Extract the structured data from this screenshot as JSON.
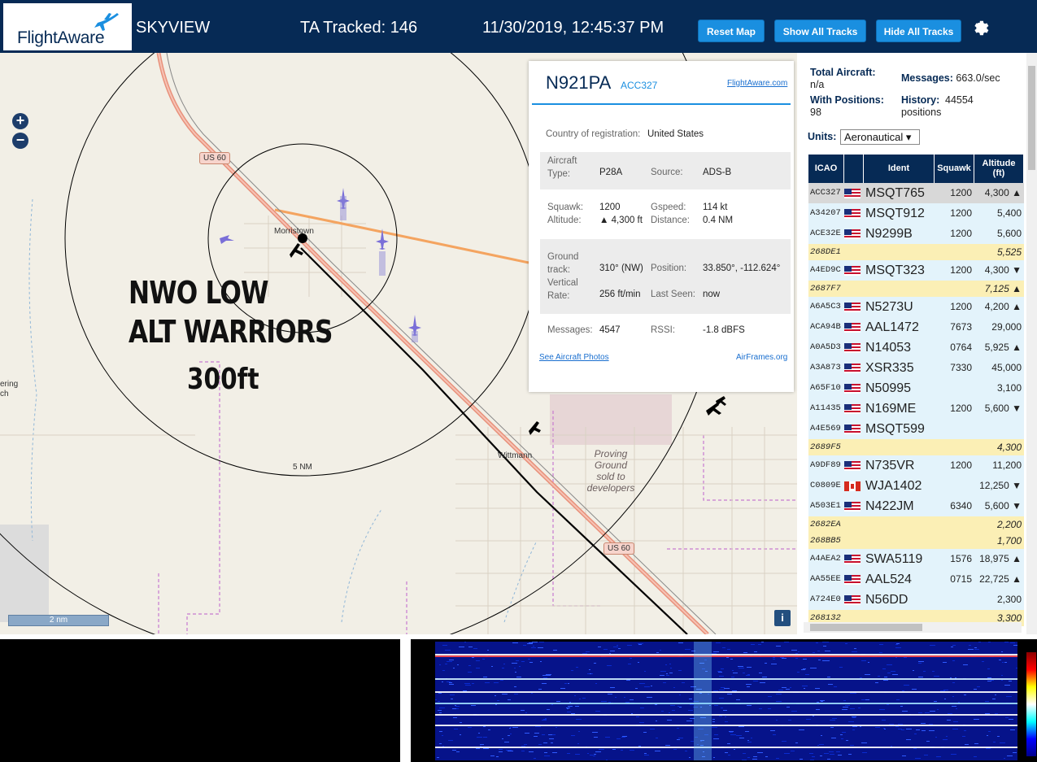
{
  "header": {
    "logo_text": "FlightAware",
    "app_title": "SKYVIEW",
    "ta_tracked": "TA Tracked: 146",
    "datetime": "11/30/2019, 12:45:37 PM",
    "buttons": {
      "reset": "Reset Map",
      "show": "Show All Tracks",
      "hide": "Hide All Tracks"
    },
    "settings_icon": "gear-icon"
  },
  "map": {
    "zoom_in": "+",
    "zoom_out": "−",
    "scale_label": "2 nm",
    "ring_label": "5 NM",
    "info_label": "i",
    "place_labels": {
      "morristown": "Morristown",
      "wittmann": "Wittmann",
      "us60a": "US 60",
      "us60b": "US 60",
      "left_fragment": "ering\nch"
    },
    "proving_ground": "Proving\nGround\nsold to\ndevelopers",
    "overlay": {
      "line1": "NWO LOW",
      "line2": "ALT WARRIORS",
      "line3": "300ft"
    }
  },
  "popup": {
    "registration": "N921PA",
    "icao": "ACC327",
    "fa_link": "FlightAware.com",
    "country_label": "Country of registration:",
    "country_value": "United States",
    "aircraft_type_label": "Aircraft\nType:",
    "aircraft_type_value": "P28A",
    "source_label": "Source:",
    "source_value": "ADS-B",
    "squawk_label": "Squawk:",
    "squawk_value": "1200",
    "gspeed_label": "Gspeed:",
    "gspeed_value": "114 kt",
    "altitude_label": "Altitude:",
    "altitude_value": "▲ 4,300 ft",
    "distance_label": "Distance:",
    "distance_value": "0.4 NM",
    "ground_track_label": "Ground\ntrack:",
    "ground_track_value": "310° (NW)",
    "position_label": "Position:",
    "position_value": "33.850°, -112.624°",
    "vrate_label": "Vertical\nRate:",
    "vrate_value": "256 ft/min",
    "last_seen_label": "Last Seen:",
    "last_seen_value": "now",
    "messages_label": "Messages:",
    "messages_value": "4547",
    "rssi_label": "RSSI:",
    "rssi_value": "-1.8 dBFS",
    "photos_link": "See Aircraft Photos",
    "airframes_link": "AirFrames.org"
  },
  "stats": {
    "total_label": "Total Aircraft:",
    "total_value": "n/a",
    "messages_label": "Messages:",
    "messages_value": "663.0/sec",
    "positions_label": "With Positions:",
    "positions_value": "98",
    "history_label": "History:",
    "history_value": "44554\npositions",
    "units_label": "Units:",
    "units_value": "Aeronautical ▾"
  },
  "table": {
    "headers": [
      "ICAO",
      "",
      "Ident",
      "Squawk",
      "Altitude\n(ft)"
    ],
    "rows": [
      {
        "icao": "ACC327",
        "flag": "us",
        "ident": "MSQT765",
        "squawk": "1200",
        "alt": "4,300 ▲",
        "bg": "#d8d8d8"
      },
      {
        "icao": "A34207",
        "flag": "us",
        "ident": "MSQT912",
        "squawk": "1200",
        "alt": "5,400",
        "bg": "#e3f3fb"
      },
      {
        "icao": "ACE32E",
        "flag": "us",
        "ident": "N9299B",
        "squawk": "1200",
        "alt": "5,600",
        "bg": "#e3f3fb"
      },
      {
        "icao": "268DE1",
        "flag": "",
        "ident": "",
        "squawk": "",
        "alt": "5,525",
        "bg": "#fbefb5"
      },
      {
        "icao": "A4ED9C",
        "flag": "us",
        "ident": "MSQT323",
        "squawk": "1200",
        "alt": "4,300 ▼",
        "bg": "#e3f3fb"
      },
      {
        "icao": "2687F7",
        "flag": "",
        "ident": "",
        "squawk": "",
        "alt": "7,125 ▲",
        "bg": "#fbefb5"
      },
      {
        "icao": "A6A5C3",
        "flag": "us",
        "ident": "N5273U",
        "squawk": "1200",
        "alt": "4,200 ▲",
        "bg": "#e3f3fb"
      },
      {
        "icao": "ACA94B",
        "flag": "us",
        "ident": "AAL1472",
        "squawk": "7673",
        "alt": "29,000",
        "bg": "#e3f3fb"
      },
      {
        "icao": "A0A5D3",
        "flag": "us",
        "ident": "N14053",
        "squawk": "0764",
        "alt": "5,925 ▲",
        "bg": "#e3f3fb"
      },
      {
        "icao": "A3A873",
        "flag": "us",
        "ident": "XSR335",
        "squawk": "7330",
        "alt": "45,000",
        "bg": "#e3f3fb"
      },
      {
        "icao": "A65F10",
        "flag": "us",
        "ident": "N50995",
        "squawk": "",
        "alt": "3,100",
        "bg": "#e3f3fb"
      },
      {
        "icao": "A11435",
        "flag": "us",
        "ident": "N169ME",
        "squawk": "1200",
        "alt": "5,600 ▼",
        "bg": "#e3f3fb"
      },
      {
        "icao": "A4E569",
        "flag": "us",
        "ident": "MSQT599",
        "squawk": "",
        "alt": "",
        "bg": "#e3f3fb"
      },
      {
        "icao": "2689F5",
        "flag": "",
        "ident": "",
        "squawk": "",
        "alt": "4,300",
        "bg": "#fbefb5"
      },
      {
        "icao": "A9DF89",
        "flag": "us",
        "ident": "N735VR",
        "squawk": "1200",
        "alt": "11,200",
        "bg": "#e3f3fb"
      },
      {
        "icao": "C0809E",
        "flag": "ca",
        "ident": "WJA1402",
        "squawk": "",
        "alt": "12,250 ▼",
        "bg": "#e3f3fb"
      },
      {
        "icao": "A503E1",
        "flag": "us",
        "ident": "N422JM",
        "squawk": "6340",
        "alt": "5,600 ▼",
        "bg": "#e3f3fb"
      },
      {
        "icao": "2682EA",
        "flag": "",
        "ident": "",
        "squawk": "",
        "alt": "2,200",
        "bg": "#fbefb5"
      },
      {
        "icao": "268BB5",
        "flag": "",
        "ident": "",
        "squawk": "",
        "alt": "1,700",
        "bg": "#fbefb5"
      },
      {
        "icao": "A4AEA2",
        "flag": "us",
        "ident": "SWA5119",
        "squawk": "1576",
        "alt": "18,975 ▲",
        "bg": "#e3f3fb"
      },
      {
        "icao": "AA55EE",
        "flag": "us",
        "ident": "AAL524",
        "squawk": "0715",
        "alt": "22,725 ▲",
        "bg": "#e3f3fb"
      },
      {
        "icao": "A724E0",
        "flag": "us",
        "ident": "N56DD",
        "squawk": "",
        "alt": "2,300",
        "bg": "#e3f3fb"
      },
      {
        "icao": "268132",
        "flag": "",
        "ident": "",
        "squawk": "",
        "alt": "3,300",
        "bg": "#fbefb5"
      }
    ]
  },
  "colors": {
    "header_bg": "#062a55",
    "button_bg": "#1a8fe0",
    "selected_track": "#000000",
    "range_ring": "#000000"
  }
}
